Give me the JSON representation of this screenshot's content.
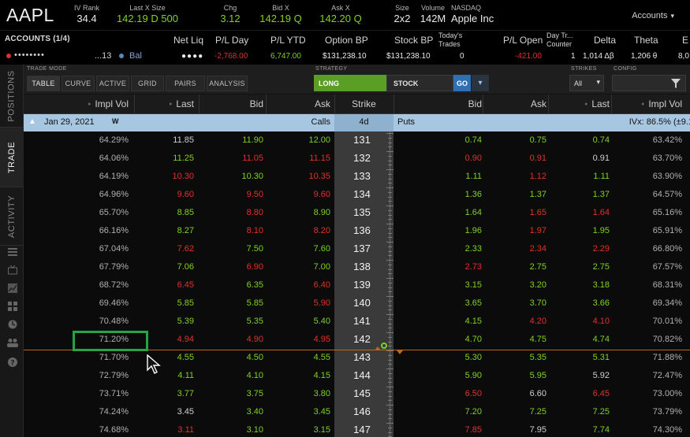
{
  "quote": {
    "symbol": "AAPL",
    "iv_rank_label": "IV Rank",
    "iv_rank_value": "34.4",
    "last_label": "Last X Size",
    "last_value": "142.19 D 500",
    "chg_label": "Chg",
    "chg_value": "3.12",
    "bid_label": "Bid X",
    "bid_value": "142.19 Q",
    "ask_label": "Ask X",
    "ask_value": "142.20 Q",
    "size_label": "Size",
    "size_value": "2x2",
    "volume_label": "Volume",
    "volume_value": "142M",
    "exchange_label": "NASDAQ",
    "company": "Apple Inc",
    "accounts_button": "Accounts"
  },
  "account": {
    "title": "ACCOUNTS (1/4)",
    "masked": "••••••••",
    "num": "...13",
    "bal_label": "Bal",
    "headers": {
      "net_liq": "Net Liq",
      "pl_day": "P/L Day",
      "pl_ytd": "P/L YTD",
      "option_bp": "Option BP",
      "stock_bp": "Stock BP",
      "todays_trades": "Today's Trades",
      "pl_open": "P/L Open",
      "day_trade_counter": "Day Tr... Counter",
      "delta": "Delta",
      "theta": "Theta",
      "extra": "E"
    },
    "values": {
      "net_liq": "●●●●",
      "pl_day": "-2,768.00",
      "pl_ytd": "6,747.00",
      "option_bp": "$131,238.10",
      "stock_bp": "$131,238.10",
      "todays_trades": "0",
      "pl_open": "-421.00",
      "day_trade_counter": "1",
      "delta": "1,014 Δβ",
      "theta": "1,206 θ",
      "extra": "8,0"
    }
  },
  "side_tabs": {
    "positions": "POSITIONS",
    "trade": "TRADE",
    "activity": "ACTIVITY"
  },
  "controls": {
    "trade_mode_label": "TRADE MODE",
    "modes": [
      "TABLE",
      "CURVE",
      "ACTIVE",
      "GRID",
      "PAIRS",
      "ANALYSIS"
    ],
    "strategy_label": "STRATEGY",
    "long": "LONG",
    "stock": "STOCK",
    "go": "GO",
    "strikes_label": "STRIKES",
    "strikes_value": "All",
    "config_label": "CONFIG"
  },
  "columns": {
    "call_iv": "Impl Vol",
    "call_last": "Last",
    "call_bid": "Bid",
    "call_ask": "Ask",
    "strike": "Strike",
    "put_bid": "Bid",
    "put_ask": "Ask",
    "put_last": "Last",
    "put_iv": "Impl Vol"
  },
  "expiration": {
    "date": "Jan 29, 2021",
    "week": "W",
    "calls": "Calls",
    "days": "4d",
    "puts": "Puts",
    "ivx": "IVx: 86.5% (±9.1"
  },
  "rows": [
    {
      "strike": "131",
      "c_iv": "64.29%",
      "c_last": "11.85",
      "c_last_c": "white",
      "c_bid": "11.90",
      "c_bid_c": "green",
      "c_ask": "12.00",
      "c_ask_c": "green",
      "p_bid": "0.74",
      "p_bid_c": "green",
      "p_ask": "0.75",
      "p_ask_c": "green",
      "p_last": "0.74",
      "p_last_c": "green",
      "p_iv": "63.42%"
    },
    {
      "strike": "132",
      "c_iv": "64.06%",
      "c_last": "11.25",
      "c_last_c": "green",
      "c_bid": "11.05",
      "c_bid_c": "red",
      "c_ask": "11.15",
      "c_ask_c": "red",
      "p_bid": "0.90",
      "p_bid_c": "red",
      "p_ask": "0.91",
      "p_ask_c": "red",
      "p_last": "0.91",
      "p_last_c": "white",
      "p_iv": "63.70%"
    },
    {
      "strike": "133",
      "c_iv": "64.19%",
      "c_last": "10.30",
      "c_last_c": "red",
      "c_bid": "10.30",
      "c_bid_c": "green",
      "c_ask": "10.35",
      "c_ask_c": "red",
      "p_bid": "1.11",
      "p_bid_c": "green",
      "p_ask": "1.12",
      "p_ask_c": "red",
      "p_last": "1.11",
      "p_last_c": "green",
      "p_iv": "63.90%"
    },
    {
      "strike": "134",
      "c_iv": "64.96%",
      "c_last": "9.60",
      "c_last_c": "red",
      "c_bid": "9.50",
      "c_bid_c": "red",
      "c_ask": "9.60",
      "c_ask_c": "red",
      "p_bid": "1.36",
      "p_bid_c": "green",
      "p_ask": "1.37",
      "p_ask_c": "green",
      "p_last": "1.37",
      "p_last_c": "green",
      "p_iv": "64.57%"
    },
    {
      "strike": "135",
      "c_iv": "65.70%",
      "c_last": "8.85",
      "c_last_c": "green",
      "c_bid": "8.80",
      "c_bid_c": "red",
      "c_ask": "8.90",
      "c_ask_c": "green",
      "p_bid": "1.64",
      "p_bid_c": "green",
      "p_ask": "1.65",
      "p_ask_c": "red",
      "p_last": "1.64",
      "p_last_c": "red",
      "p_iv": "65.16%"
    },
    {
      "strike": "136",
      "c_iv": "66.16%",
      "c_last": "8.27",
      "c_last_c": "green",
      "c_bid": "8.10",
      "c_bid_c": "red",
      "c_ask": "8.20",
      "c_ask_c": "red",
      "p_bid": "1.96",
      "p_bid_c": "green",
      "p_ask": "1.97",
      "p_ask_c": "red",
      "p_last": "1.95",
      "p_last_c": "green",
      "p_iv": "65.91%"
    },
    {
      "strike": "137",
      "c_iv": "67.04%",
      "c_last": "7.62",
      "c_last_c": "red",
      "c_bid": "7.50",
      "c_bid_c": "green",
      "c_ask": "7.60",
      "c_ask_c": "green",
      "p_bid": "2.33",
      "p_bid_c": "green",
      "p_ask": "2.34",
      "p_ask_c": "red",
      "p_last": "2.29",
      "p_last_c": "red",
      "p_iv": "66.80%"
    },
    {
      "strike": "138",
      "c_iv": "67.79%",
      "c_last": "7.06",
      "c_last_c": "green",
      "c_bid": "6.90",
      "c_bid_c": "red",
      "c_ask": "7.00",
      "c_ask_c": "green",
      "p_bid": "2.73",
      "p_bid_c": "red",
      "p_ask": "2.75",
      "p_ask_c": "green",
      "p_last": "2.75",
      "p_last_c": "green",
      "p_iv": "67.57%"
    },
    {
      "strike": "139",
      "c_iv": "68.72%",
      "c_last": "6.45",
      "c_last_c": "red",
      "c_bid": "6.35",
      "c_bid_c": "green",
      "c_ask": "6.40",
      "c_ask_c": "red",
      "p_bid": "3.15",
      "p_bid_c": "green",
      "p_ask": "3.20",
      "p_ask_c": "green",
      "p_last": "3.18",
      "p_last_c": "green",
      "p_iv": "68.31%"
    },
    {
      "strike": "140",
      "c_iv": "69.46%",
      "c_last": "5.85",
      "c_last_c": "green",
      "c_bid": "5.85",
      "c_bid_c": "green",
      "c_ask": "5.90",
      "c_ask_c": "red",
      "p_bid": "3.65",
      "p_bid_c": "green",
      "p_ask": "3.70",
      "p_ask_c": "green",
      "p_last": "3.66",
      "p_last_c": "green",
      "p_iv": "69.34%"
    },
    {
      "strike": "141",
      "c_iv": "70.48%",
      "c_last": "5.39",
      "c_last_c": "green",
      "c_bid": "5.35",
      "c_bid_c": "green",
      "c_ask": "5.40",
      "c_ask_c": "green",
      "p_bid": "4.15",
      "p_bid_c": "green",
      "p_ask": "4.20",
      "p_ask_c": "red",
      "p_last": "4.10",
      "p_last_c": "red",
      "p_iv": "70.01%"
    },
    {
      "strike": "142",
      "c_iv": "71.20%",
      "c_last": "4.94",
      "c_last_c": "red",
      "c_bid": "4.90",
      "c_bid_c": "red",
      "c_ask": "4.95",
      "c_ask_c": "red",
      "p_bid": "4.70",
      "p_bid_c": "green",
      "p_ask": "4.75",
      "p_ask_c": "green",
      "p_last": "4.74",
      "p_last_c": "green",
      "p_iv": "70.82%"
    },
    {
      "strike": "143",
      "c_iv": "71.70%",
      "c_last": "4.55",
      "c_last_c": "green",
      "c_bid": "4.50",
      "c_bid_c": "green",
      "c_ask": "4.55",
      "c_ask_c": "green",
      "p_bid": "5.30",
      "p_bid_c": "green",
      "p_ask": "5.35",
      "p_ask_c": "green",
      "p_last": "5.31",
      "p_last_c": "green",
      "p_iv": "71.88%"
    },
    {
      "strike": "144",
      "c_iv": "72.79%",
      "c_last": "4.11",
      "c_last_c": "green",
      "c_bid": "4.10",
      "c_bid_c": "green",
      "c_ask": "4.15",
      "c_ask_c": "green",
      "p_bid": "5.90",
      "p_bid_c": "green",
      "p_ask": "5.95",
      "p_ask_c": "green",
      "p_last": "5.92",
      "p_last_c": "white",
      "p_iv": "72.47%"
    },
    {
      "strike": "145",
      "c_iv": "73.71%",
      "c_last": "3.77",
      "c_last_c": "green",
      "c_bid": "3.75",
      "c_bid_c": "green",
      "c_ask": "3.80",
      "c_ask_c": "green",
      "p_bid": "6.50",
      "p_bid_c": "red",
      "p_ask": "6.60",
      "p_ask_c": "white",
      "p_last": "6.45",
      "p_last_c": "red",
      "p_iv": "73.00%"
    },
    {
      "strike": "146",
      "c_iv": "74.24%",
      "c_last": "3.45",
      "c_last_c": "white",
      "c_bid": "3.40",
      "c_bid_c": "green",
      "c_ask": "3.45",
      "c_ask_c": "green",
      "p_bid": "7.20",
      "p_bid_c": "green",
      "p_ask": "7.25",
      "p_ask_c": "green",
      "p_last": "7.25",
      "p_last_c": "green",
      "p_iv": "73.79%"
    },
    {
      "strike": "147",
      "c_iv": "74.68%",
      "c_last": "3.11",
      "c_last_c": "red",
      "c_bid": "3.10",
      "c_bid_c": "green",
      "c_ask": "3.15",
      "c_ask_c": "green",
      "p_bid": "7.85",
      "p_bid_c": "red",
      "p_ask": "7.95",
      "p_ask_c": "white",
      "p_last": "7.74",
      "p_last_c": "green",
      "p_iv": "74.30%"
    }
  ]
}
